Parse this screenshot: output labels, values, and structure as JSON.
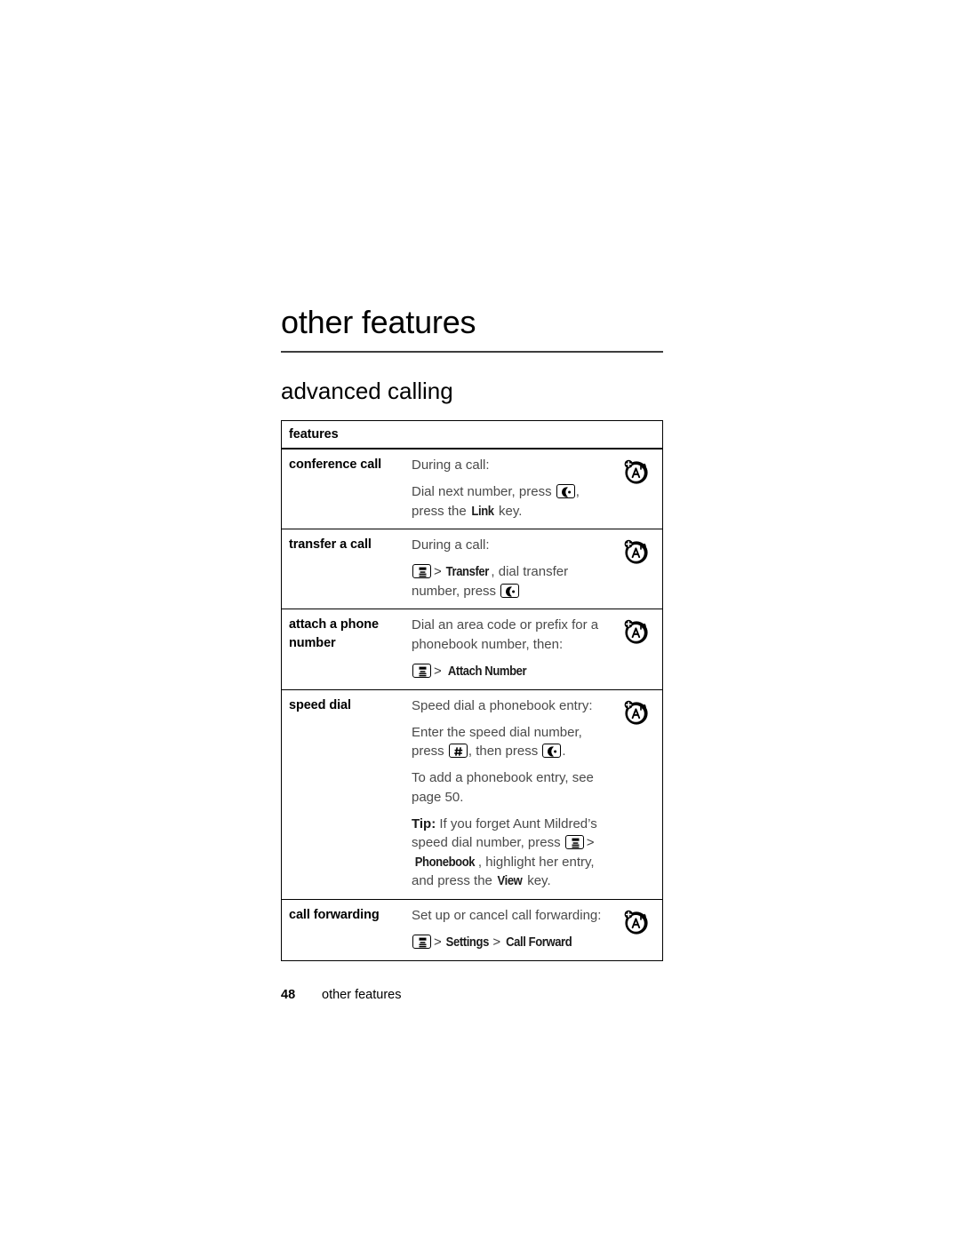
{
  "document": {
    "chapter_title": "other features",
    "section_title": "advanced calling"
  },
  "table": {
    "header_label": "features",
    "rows": [
      {
        "label": "conference call",
        "icon": "network-a-icon",
        "paragraphs": [
          {
            "parts": [
              {
                "type": "text",
                "value": "During a call:"
              }
            ]
          },
          {
            "parts": [
              {
                "type": "text",
                "value": "Dial next number, press "
              },
              {
                "type": "icon",
                "value": "send-key-icon"
              },
              {
                "type": "text",
                "value": ", press the "
              },
              {
                "type": "keyname",
                "value": "Link"
              },
              {
                "type": "text",
                "value": " key."
              }
            ]
          }
        ]
      },
      {
        "label": "transfer a call",
        "icon": "network-a-icon",
        "paragraphs": [
          {
            "parts": [
              {
                "type": "text",
                "value": "During a call:"
              }
            ]
          },
          {
            "parts": [
              {
                "type": "icon",
                "value": "menu-key-icon"
              },
              {
                "type": "gt",
                "value": ">"
              },
              {
                "type": "keyname",
                "value": "Transfer"
              },
              {
                "type": "text",
                "value": ", dial transfer number, press "
              },
              {
                "type": "icon",
                "value": "send-key-icon"
              }
            ]
          }
        ]
      },
      {
        "label": "attach a phone number",
        "icon": "network-a-icon",
        "paragraphs": [
          {
            "parts": [
              {
                "type": "text",
                "value": "Dial an area code or prefix for a phonebook number, then:"
              }
            ]
          },
          {
            "parts": [
              {
                "type": "icon",
                "value": "menu-key-icon"
              },
              {
                "type": "gt",
                "value": ">"
              },
              {
                "type": "keyname",
                "value": "Attach Number"
              }
            ]
          }
        ]
      },
      {
        "label": "speed dial",
        "icon": "network-a-icon",
        "paragraphs": [
          {
            "parts": [
              {
                "type": "text",
                "value": "Speed dial a phonebook entry:"
              }
            ]
          },
          {
            "parts": [
              {
                "type": "text",
                "value": "Enter the speed dial number, press "
              },
              {
                "type": "icon",
                "value": "pound-key-icon"
              },
              {
                "type": "text",
                "value": ", then press "
              },
              {
                "type": "icon",
                "value": "send-key-icon"
              },
              {
                "type": "text",
                "value": "."
              }
            ]
          },
          {
            "parts": [
              {
                "type": "text",
                "value": "To add a phonebook entry, see page 50."
              }
            ]
          },
          {
            "parts": [
              {
                "type": "tipword",
                "value": "Tip:"
              },
              {
                "type": "text",
                "value": " If you forget Aunt Mildred’s speed dial number, press "
              },
              {
                "type": "icon",
                "value": "menu-key-icon"
              },
              {
                "type": "gt",
                "value": ">"
              },
              {
                "type": "keyname",
                "value": "Phonebook"
              },
              {
                "type": "text",
                "value": ", highlight her entry, and press the "
              },
              {
                "type": "keyname",
                "value": "View"
              },
              {
                "type": "text",
                "value": " key."
              }
            ]
          }
        ]
      },
      {
        "label": "call forwarding",
        "icon": "network-a-icon",
        "paragraphs": [
          {
            "parts": [
              {
                "type": "text",
                "value": "Set up or cancel call forwarding:"
              }
            ]
          },
          {
            "parts": [
              {
                "type": "icon",
                "value": "menu-key-icon"
              },
              {
                "type": "gt",
                "value": ">"
              },
              {
                "type": "keyname",
                "value": "Settings"
              },
              {
                "type": "gt",
                "value": ">"
              },
              {
                "type": "keyname",
                "value": "Call Forward"
              }
            ]
          }
        ]
      }
    ]
  },
  "footer": {
    "page_number": "48",
    "page_label": "other features"
  },
  "colors": {
    "body_text": "#4a4a4a",
    "label_text": "#000000",
    "rule": "#3d3d3d",
    "border": "#000000"
  }
}
